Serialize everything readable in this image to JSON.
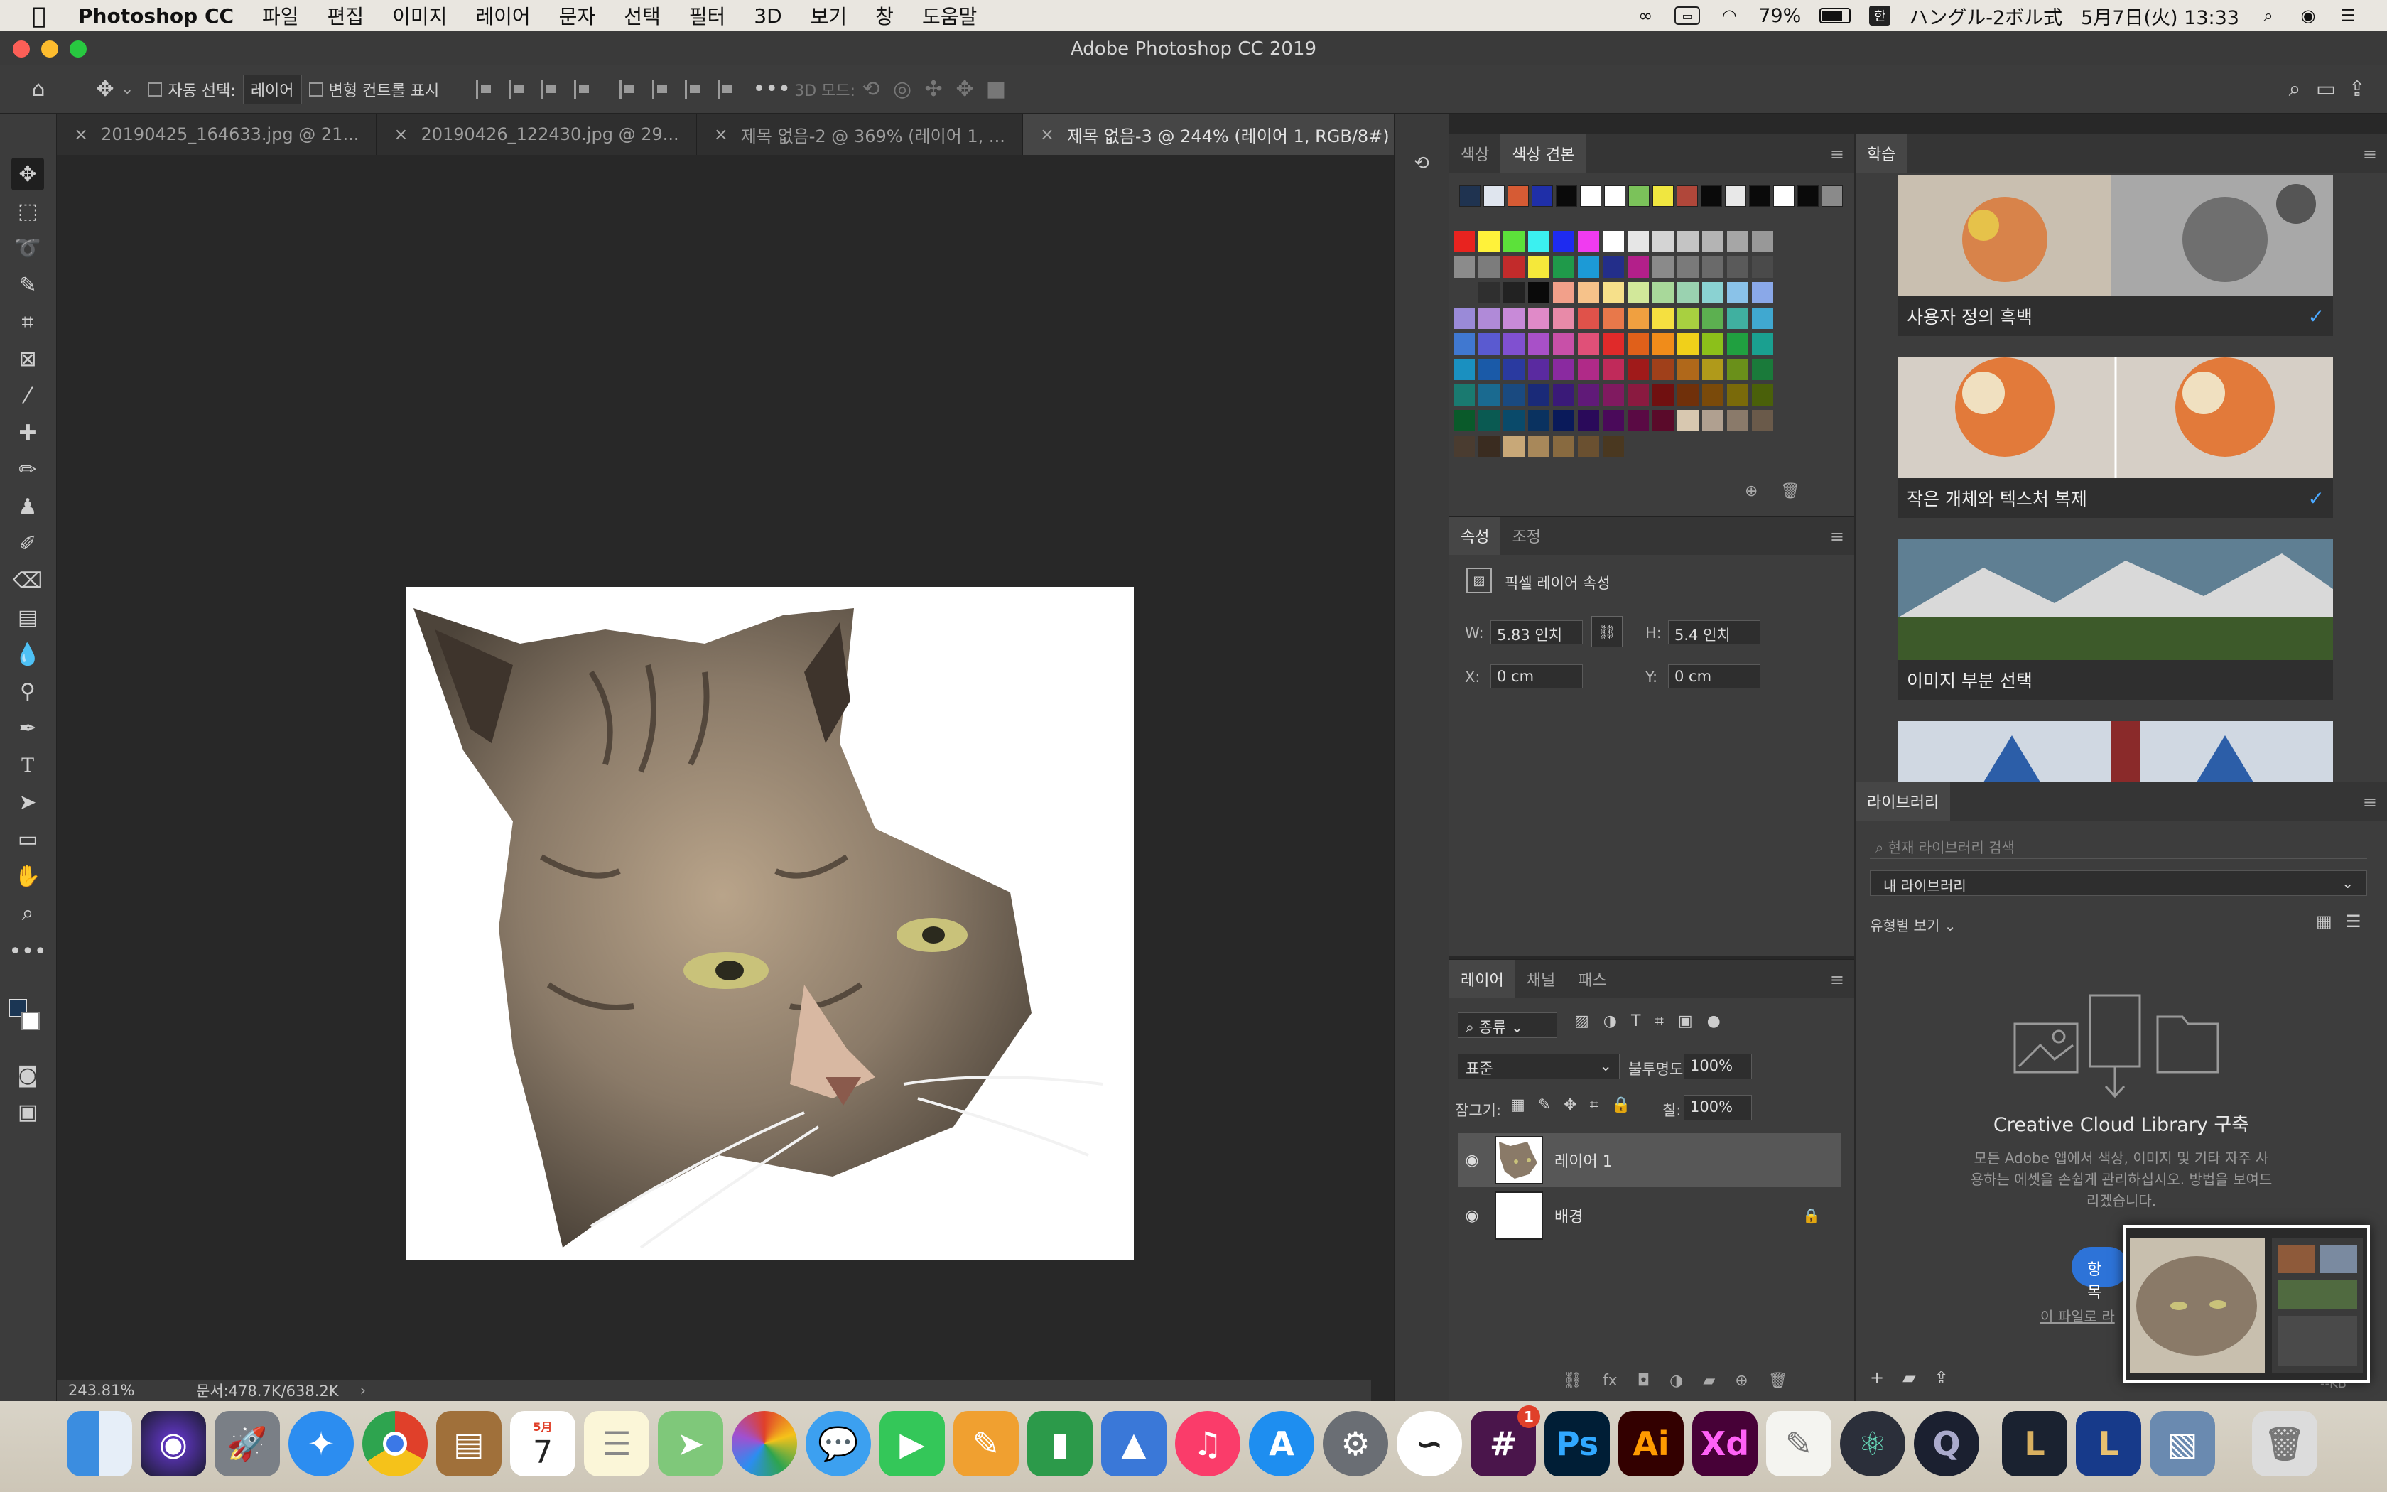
{
  "menubar": {
    "app_name": "Photoshop CC",
    "menus": [
      "파일",
      "편집",
      "이미지",
      "레이어",
      "문자",
      "선택",
      "필터",
      "3D",
      "보기",
      "창",
      "도움말"
    ],
    "battery": "79%",
    "input_method": "ハングル-2ボル式",
    "input_badge": "한",
    "datetime": "5月7日(火)  13:33"
  },
  "window": {
    "title": "Adobe Photoshop CC 2019"
  },
  "options": {
    "auto_select_label": "자동 선택:",
    "auto_select_value": "레이어",
    "transform_label": "변형 컨트롤 표시",
    "three_d_mode": "3D 모드:"
  },
  "tabs": [
    {
      "label": "20190425_164633.jpg @ 21..."
    },
    {
      "label": "20190426_122430.jpg @ 29..."
    },
    {
      "label": "제목 없음-2 @ 369% (레이어 1, ..."
    },
    {
      "label": "제목 없음-3 @ 244% (레이어 1, RGB/8#) *"
    }
  ],
  "status": {
    "zoom": "243.81%",
    "doc": "문서:478.7K/638.2K"
  },
  "swatches": {
    "tab_color": "색상",
    "tab_swatches": "색상 견본",
    "recent": [
      "#1f3350",
      "#dfe5ee",
      "#d65b34",
      "#1f2fa8",
      "#0a0a0a",
      "#ffffff",
      "#ffffff",
      "#7bc25a",
      "#f0e640",
      "#b0473a",
      "#0a0a0a",
      "#e8e8e8",
      "#0a0a0a",
      "#ffffff",
      "#0a0a0a",
      "#8a8a8a"
    ],
    "grid": [
      [
        "#e8231f",
        "#fff23a",
        "#5ce13a",
        "#3bf0f0",
        "#1e2bf0",
        "#f03bf0",
        "#ffffff",
        "#e6e6e6",
        "#d4d4d4",
        "#c4c4c4",
        "#b4b4b4",
        "#a6a6a6",
        "#989898"
      ],
      [
        "#8b8b8b",
        "#7c7c7c",
        "#c22b2b",
        "#f5e83a",
        "#1f9a4a",
        "#1c9ad6",
        "#232e8a",
        "#b31f8a",
        "#8a8a8a",
        "#7a7a7a",
        "#6a6a6a",
        "#5a5a5a",
        "#4a4a4a"
      ],
      [
        "#3d3d3d",
        "#2f2f2f",
        "#222222",
        "#0a0a0a",
        "#f2a08a",
        "#f6c28a",
        "#f6e08a",
        "#d2e89a",
        "#a8d89a",
        "#9ad2b0",
        "#8ad2d2",
        "#8ac2e8",
        "#8aa8e8"
      ],
      [
        "#9a8ad8",
        "#b08ad8",
        "#c88ad8",
        "#e08ac8",
        "#e88aa8",
        "#e0524a",
        "#e8784a",
        "#f0a040",
        "#f5e040",
        "#a8d040",
        "#5cb050",
        "#40b0a0",
        "#40a8d0"
      ],
      [
        "#4078d0",
        "#5a5ad0",
        "#8050d0",
        "#a850c8",
        "#c850a8",
        "#e05078",
        "#e02a2a",
        "#e0601a",
        "#f08c1a",
        "#f0d01a",
        "#8cc01a",
        "#20a040",
        "#1aa090"
      ],
      [
        "#1a90c0",
        "#1a5aa8",
        "#2a3aa0",
        "#5a2aa0",
        "#8a2aa0",
        "#b02a88",
        "#c02a5a",
        "#a01a1a",
        "#a0401a",
        "#b0681a",
        "#b09a1a",
        "#6a901a",
        "#1a7a3a"
      ],
      [
        "#1a7a70",
        "#1a6a90",
        "#1a4a80",
        "#1a2a78",
        "#3a1a78",
        "#601a78",
        "#801a60",
        "#8a1a40",
        "#701010",
        "#70300a",
        "#7a4a0a",
        "#7a6a0a",
        "#4a600a"
      ],
      [
        "#0a5a2a",
        "#0a5a52",
        "#0a4a6a",
        "#0a3260",
        "#0a1a5a",
        "#2a0a5a",
        "#4a0a5a",
        "#5a0a44",
        "#5a0a2a",
        "#d8c8b0",
        "#b0a090",
        "#8a7a6a",
        "#6a5a4a"
      ],
      [
        "#4a3c30",
        "#3a2c20",
        "#c8a878",
        "#a8885a",
        "#886a40",
        "#6a5030",
        "#4a3820"
      ]
    ]
  },
  "properties": {
    "tab_props": "속성",
    "tab_adjust": "조정",
    "header": "픽셀 레이어 속성",
    "w_label": "W:",
    "w_value": "5.83 인치",
    "h_label": "H:",
    "h_value": "5.4 인치",
    "x_label": "X:",
    "x_value": "0 cm",
    "y_label": "Y:",
    "y_value": "0 cm"
  },
  "layers": {
    "tab_layers": "레이어",
    "tab_channels": "채널",
    "tab_paths": "패스",
    "filter_kind": "종류",
    "blend_mode": "표준",
    "opacity_label": "불투명도:",
    "opacity_value": "100%",
    "lock_label": "잠그기:",
    "fill_label": "칠:",
    "fill_value": "100%",
    "items": [
      {
        "name": "레이어 1"
      },
      {
        "name": "배경"
      }
    ]
  },
  "learn": {
    "title": "학습",
    "cards": [
      {
        "label": "사용자 정의 흑백",
        "done": true
      },
      {
        "label": "작은 개체와 텍스처 복제",
        "done": true
      },
      {
        "label": "이미지 부분 선택",
        "done": false
      }
    ]
  },
  "libraries": {
    "title": "라이브러리",
    "search_placeholder": "현재 라이브러리 검색",
    "library_select": "내 라이브러리",
    "view_by": "유형별 보기",
    "heading": "Creative Cloud Library 구축",
    "body_lines": [
      "모든 Adobe 앱에서 색상, 이미지 및 기타 자주 사",
      "용하는 에셋을 손쉽게 관리하십시오. 방법을 보여드",
      "리겠습니다."
    ],
    "button_fragment": "항목",
    "link_fragment": "이 파일로 라",
    "kb_fragment": "--KB"
  },
  "dock": {
    "calendar_month": "5月",
    "calendar_day": "7",
    "slack_badge": "1",
    "ps_label": "Ps",
    "ai_label": "Ai",
    "xd_label": "Xd"
  }
}
